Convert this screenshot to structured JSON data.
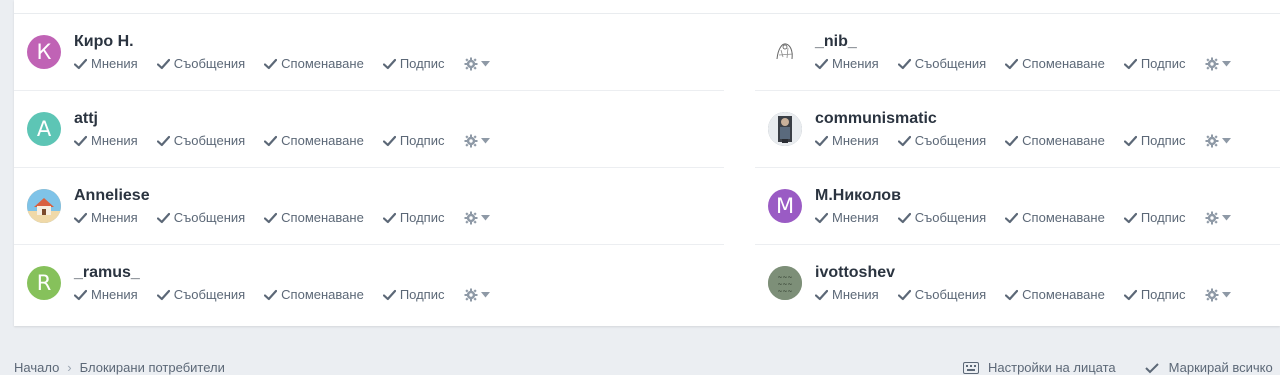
{
  "accent": "#5c6877",
  "actions": {
    "opinions": "Мнения",
    "messages": "Съобщения",
    "mentions": "Споменаване",
    "signature": "Подпис"
  },
  "users_left": [
    {
      "name": "Киро Н.",
      "avatar_letter": "К",
      "avatar_color": "#c063b5"
    },
    {
      "name": "attj",
      "avatar_letter": "A",
      "avatar_color": "#5dc5b5"
    },
    {
      "name": "Anneliese",
      "avatar_letter": "",
      "avatar_color": "#e9a25f"
    },
    {
      "name": "_ramus_",
      "avatar_letter": "R",
      "avatar_color": "#86c15b"
    }
  ],
  "users_right": [
    {
      "name": "_nib_",
      "avatar_letter": "",
      "avatar_color": "#ffffff"
    },
    {
      "name": "communismatic",
      "avatar_letter": "",
      "avatar_color": "#7a8390"
    },
    {
      "name": "М.Николов",
      "avatar_letter": "M",
      "avatar_color": "#9a5bc4"
    },
    {
      "name": "ivottoshev",
      "avatar_letter": "",
      "avatar_color": "#7d8f78"
    }
  ],
  "footer": {
    "crumb_home": "Начало",
    "crumb_current": "Блокирани потребители",
    "link_settings": "Настройки на лицата",
    "link_mark": "Маркирай всичко"
  }
}
